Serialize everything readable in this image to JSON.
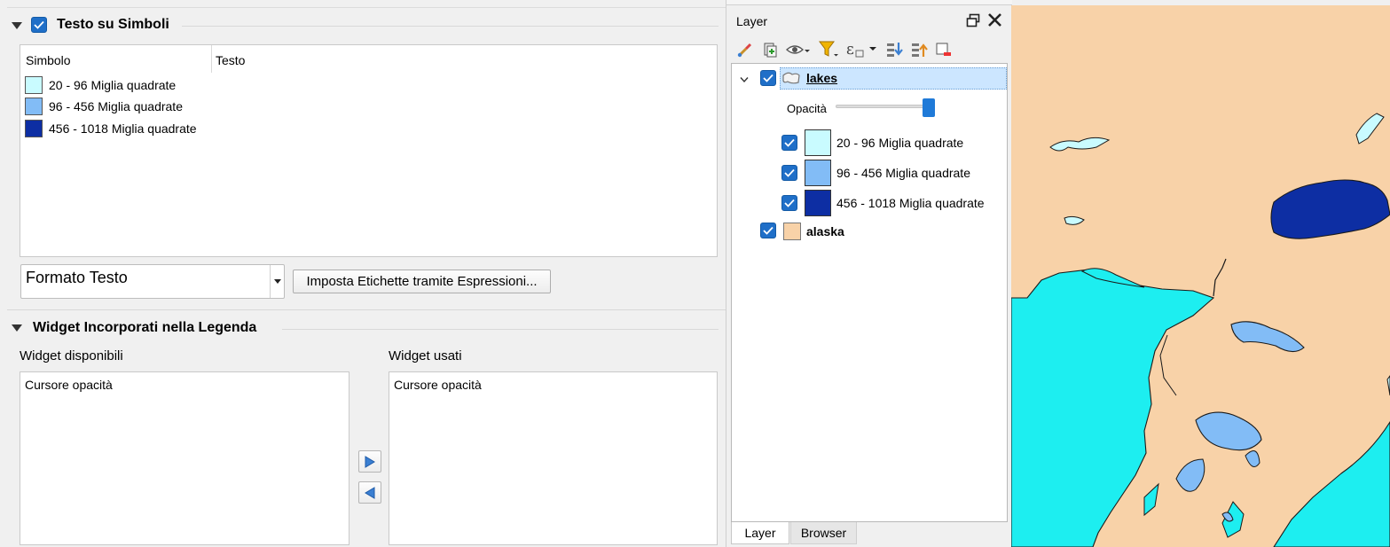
{
  "symbol_text": {
    "title": "Testo su Simboli",
    "columns": [
      "Simbolo",
      "Testo"
    ],
    "rows": [
      {
        "label": "20 - 96 Miglia quadrate",
        "color": "#c9fbff"
      },
      {
        "label": "96 - 456 Miglia quadrate",
        "color": "#82bcf6"
      },
      {
        "label": "456 - 1018 Miglia quadrate",
        "color": "#0d2ea3"
      }
    ],
    "format_combo": "Formato Testo",
    "expr_button": "Imposta Etichette tramite Espressioni..."
  },
  "widgets": {
    "title": "Widget Incorporati nella Legenda",
    "available_label": "Widget disponibili",
    "used_label": "Widget usati",
    "available_items": [
      "Cursore opacità"
    ],
    "used_items": [
      "Cursore opacità"
    ]
  },
  "layer_panel": {
    "title": "Layer",
    "layers": [
      {
        "name": "lakes",
        "checked": true,
        "expanded": true,
        "opacity_label": "Opacità",
        "opacity": 1.0,
        "classes": [
          {
            "label": "20 - 96 Miglia quadrate",
            "color": "#c9fbff",
            "checked": true
          },
          {
            "label": "96 - 456 Miglia quadrate",
            "color": "#82bcf6",
            "checked": true
          },
          {
            "label": "456 - 1018 Miglia quadrate",
            "color": "#0d2ea3",
            "checked": true
          }
        ]
      },
      {
        "name": "alaska",
        "checked": true,
        "color": "#f8d2a8"
      }
    ],
    "tabs": [
      "Layer",
      "Browser"
    ],
    "active_tab": "Layer"
  },
  "map": {
    "land_color": "#f8d2a8",
    "water_color": "#1deef0"
  }
}
